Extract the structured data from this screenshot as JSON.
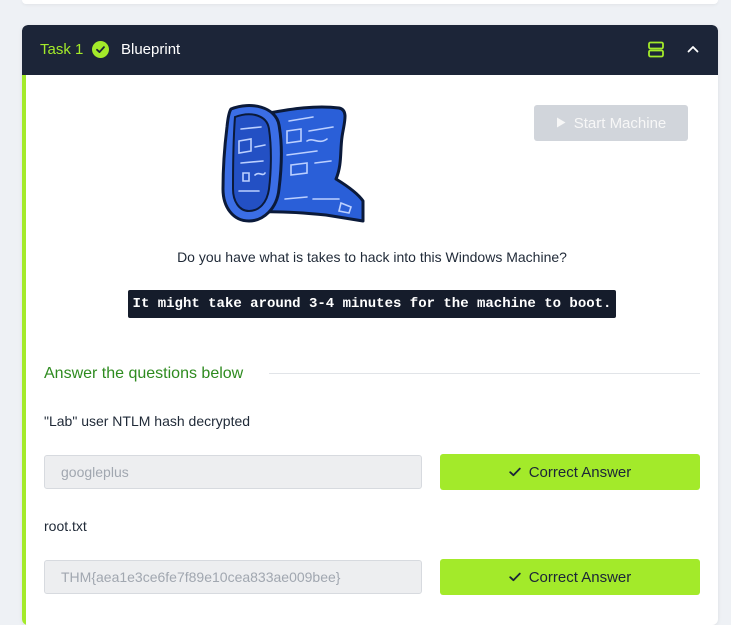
{
  "task": {
    "number_label": "Task 1",
    "title": "Blueprint",
    "completed": true
  },
  "icons": {
    "completed": "check-circle-icon",
    "layout": "split-view-icon",
    "collapse": "chevron-up-icon",
    "start": "play-icon",
    "answer_ok": "check-icon"
  },
  "start_machine": {
    "label": "Start Machine",
    "disabled": true
  },
  "intro_text": "Do you have what is takes to hack into this Windows Machine?",
  "code_note": "It might take around 3-4 minutes for the machine to boot.",
  "answers_heading": "Answer the questions below",
  "questions": [
    {
      "label": "\"Lab\" user NTLM hash decrypted",
      "answer": "googleplus",
      "button_label": "Correct Answer"
    },
    {
      "label": "root.txt",
      "answer": "THM{aea1e3ce6fe7f89e10cea833ae009bee}",
      "button_label": "Correct Answer"
    }
  ],
  "colors": {
    "accent": "#a3ea2a",
    "header_bg": "#1c2538",
    "heading_green": "#2e8b1f",
    "disabled_button": "#d1d5db",
    "blueprint_blue": "#2a5fd8"
  }
}
